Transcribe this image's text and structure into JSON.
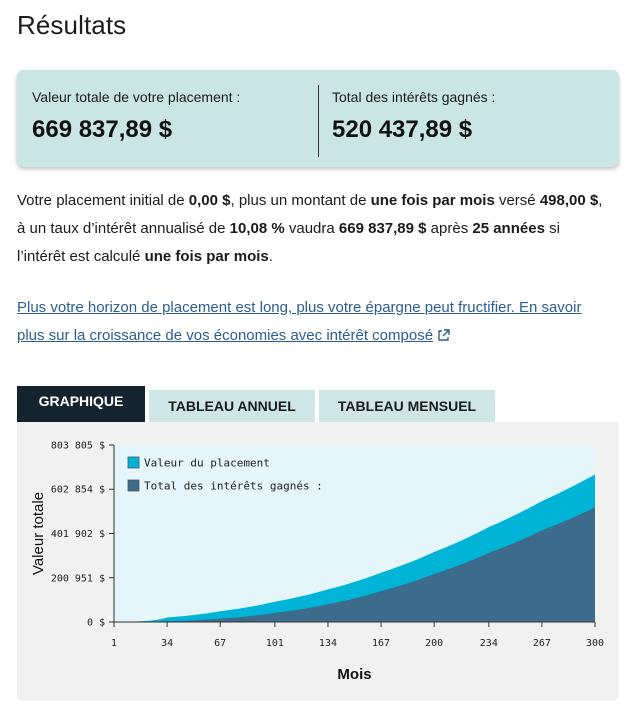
{
  "title": "Résultats",
  "summary": {
    "total_label": "Valeur totale de votre placement :",
    "total_value": "669 837,89 $",
    "interest_label": "Total des intérêts gagnés :",
    "interest_value": "520 437,89 $"
  },
  "description": {
    "p1": "Votre placement initial de ",
    "initial": "0,00 $",
    "p2": ", plus un montant de ",
    "frequency": "une fois par mois",
    "p3": " versé ",
    "amount": "498,00 $",
    "p4": ", à un taux d’intérêt annualisé de ",
    "rate": "10,08 %",
    "p5": " vaudra ",
    "final": "669 837,89 $",
    "p6": " après ",
    "years": "25 années",
    "p7": " si l’intérêt est calculé ",
    "compounding": "une fois par mois",
    "p8": "."
  },
  "link": {
    "text": "Plus votre horizon de placement est long, plus votre épargne peut fructifier. En savoir plus sur la croissance de vos économies avec intérêt composé",
    "icon": "external-link-icon"
  },
  "tabs": [
    {
      "label": "GRAPHIQUE",
      "active": true
    },
    {
      "label": "TABLEAU ANNUEL",
      "active": false
    },
    {
      "label": "TABLEAU MENSUEL",
      "active": false
    }
  ],
  "colors": {
    "summary_bg": "#c9e5e4",
    "tab_active": "#14242e",
    "tab_inactive": "#cfe6e6",
    "series_value": "#00b4d8",
    "series_interest": "#3d6b8c",
    "plot_bg": "#e4f6fa"
  },
  "chart_data": {
    "type": "area",
    "xlabel": "Mois",
    "ylabel": "Valeur totale",
    "x_ticks": [
      1,
      34,
      67,
      101,
      134,
      167,
      200,
      234,
      267,
      300
    ],
    "y_ticks": [
      "0 $",
      "200 951 $",
      "401 902 $",
      "602 854 $",
      "803 805 $"
    ],
    "y_tick_values": [
      0,
      200951,
      401902,
      602854,
      803805
    ],
    "xlim": [
      1,
      300
    ],
    "ylim": [
      0,
      803805
    ],
    "legend_position": "top-left",
    "series": [
      {
        "name": "Valeur du placement",
        "color": "#00b4d8",
        "x": [
          1,
          34,
          67,
          101,
          134,
          167,
          200,
          234,
          267,
          300
        ],
        "values": [
          498,
          20500,
          49000,
          92000,
          148000,
          224000,
          318000,
          431000,
          549000,
          669838
        ]
      },
      {
        "name": "Total des intérêts gagnés :",
        "color": "#3d6b8c",
        "x": [
          1,
          34,
          67,
          101,
          134,
          167,
          200,
          234,
          267,
          300
        ],
        "values": [
          0,
          3600,
          15600,
          41700,
          81300,
          140900,
          218400,
          314500,
          416000,
          520438
        ]
      }
    ]
  }
}
